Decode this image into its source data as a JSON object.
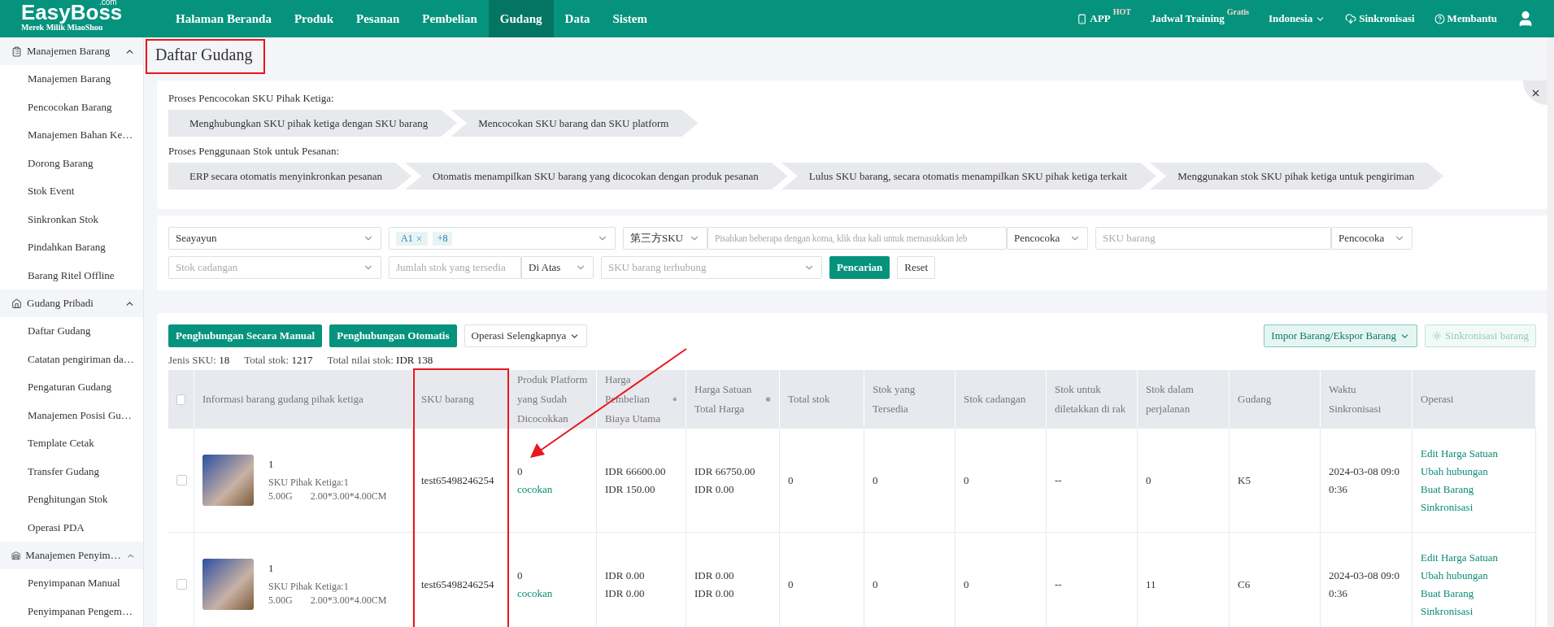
{
  "topbar": {
    "logo": {
      "brand": "EasyBoss",
      "domain": ".com",
      "subtitle": "Merek Milik MiaoShou"
    },
    "nav": [
      {
        "label": "Halaman Beranda",
        "selected": false
      },
      {
        "label": "Produk",
        "selected": false
      },
      {
        "label": "Pesanan",
        "selected": false
      },
      {
        "label": "Pembelian",
        "selected": false
      },
      {
        "label": "Gudang",
        "selected": true
      },
      {
        "label": "Data",
        "selected": false
      },
      {
        "label": "Sistem",
        "selected": false
      }
    ],
    "app": {
      "label": "APP",
      "badge": "HOT"
    },
    "training": {
      "label": "Jadwal Training",
      "badge": "Gratis"
    },
    "language": "Indonesia",
    "sync": "Sinkronisasi",
    "help": "Membantu"
  },
  "sidebar": {
    "groups": [
      {
        "label": "Manajemen Barang",
        "expanded": true,
        "children": [
          "Manajemen Barang",
          "Pencocokan Barang",
          "Manajemen Bahan Ke…",
          "Dorong Barang",
          "Stok Event",
          "Sinkronkan Stok",
          "Pindahkan Barang",
          "Barang Ritel Offline"
        ]
      },
      {
        "label": "Gudang Pribadi",
        "expanded": true,
        "children": [
          "Daftar Gudang",
          "Catatan pengiriman da…",
          "Pengaturan Gudang",
          "Manajemen Posisi Gu…",
          "Template Cetak",
          "Transfer Gudang",
          "Penghitungan Stok",
          "Operasi PDA"
        ]
      },
      {
        "label": "Manajemen Penyim…",
        "expanded": true,
        "children": [
          "Penyimpanan Manual",
          "Penyimpanan Pengem…"
        ]
      }
    ]
  },
  "page_title": "Daftar Gudang",
  "process": [
    {
      "title": "Proses Pencocokan SKU Pihak Ketiga:",
      "steps": [
        "Menghubungkan SKU pihak ketiga dengan SKU barang",
        "Mencocokan SKU barang dan SKU platform"
      ]
    },
    {
      "title": "Proses Penggunaan Stok untuk Pesanan:",
      "steps": [
        "ERP secara otomatis menyinkronkan pesanan",
        "Otomatis menampilkan SKU barang yang dicocokan dengan produk pesanan",
        "Lulus SKU barang, secara otomatis menampilkan SKU pihak ketiga terkait",
        "Menggunakan stok SKU pihak ketiga untuk pengiriman"
      ]
    }
  ],
  "filters": {
    "row_1": {
      "warehouse": "Seayayun",
      "tags": [
        "A1",
        "+8"
      ],
      "sku_type": "第三方SKU",
      "sku_input_placeholder": "Pisahkan beberapa dengan koma, klik dua kali untuk memasukkan leb",
      "match_1": "Pencocoka",
      "sku_barang_placeholder": "SKU barang",
      "match_2": "Pencocoka"
    },
    "row_2": {
      "stock_placeholder": "Stok cadangan",
      "qty_placeholder": "Jumlah stok yang tersedia",
      "qty_mode": "Di Atas",
      "linked_placeholder": "SKU barang terhubung",
      "search_button": "Pencarian",
      "reset_button": "Reset"
    }
  },
  "toolbar": {
    "manual_button": "Penghubungan Secara Manual",
    "auto_button": "Penghubungan Otomatis",
    "more_button": "Operasi Selengkapnya",
    "import_button": "Impor Barang/Ekspor Barang",
    "sync_button": "Sinkronisasi barang"
  },
  "stats": [
    {
      "label": "Jenis SKU:",
      "value": "18"
    },
    {
      "label": "Total stok:",
      "value": "1217"
    },
    {
      "label": "Total nilai stok:",
      "value": "IDR 138"
    }
  ],
  "table": {
    "header_checked": false,
    "columns": [
      {
        "label": "Informasi barang gudang pihak ketiga",
        "help": false
      },
      {
        "label": "SKU barang",
        "help": false
      },
      {
        "label": "Produk Platform yang Sudah Dicocokkan",
        "help": false
      },
      {
        "label": "Harga Pembelian Biaya Utama",
        "help": true
      },
      {
        "label": "Harga Satuan Total Harga",
        "help": true
      },
      {
        "label": "Total stok",
        "help": false
      },
      {
        "label": "Stok yang Tersedia",
        "help": false
      },
      {
        "label": "Stok cadangan",
        "help": false
      },
      {
        "label": "Stok untuk diletakkan di rak",
        "help": false
      },
      {
        "label": "Stok dalam perjalanan",
        "help": false
      },
      {
        "label": "Gudang",
        "help": false
      },
      {
        "label": "Waktu Sinkronisasi",
        "help": false
      },
      {
        "label": "Operasi",
        "help": false
      }
    ],
    "rows": [
      {
        "checked": false,
        "name": "1",
        "third_sku": "SKU Pihak Ketiga:1",
        "weight": "5.00G",
        "size": "2.00*3.00*4.00CM",
        "sku": "test65498246254",
        "matched": "0",
        "match_link": "cocokan",
        "purchase": [
          "IDR 66600.00",
          "IDR 150.00"
        ],
        "unit": [
          "IDR 66750.00",
          "IDR 0.00"
        ],
        "total": "0",
        "available": "0",
        "reserve": "0",
        "shelf": "--",
        "transit": "0",
        "warehouse": "K5",
        "time": "2024-03-08 09:00:36",
        "actions": [
          "Edit Harga Satuan",
          "Ubah hubungan",
          "Buat Barang",
          "Sinkronisasi"
        ]
      },
      {
        "checked": false,
        "name": "1",
        "third_sku": "SKU Pihak Ketiga:1",
        "weight": "5.00G",
        "size": "2.00*3.00*4.00CM",
        "sku": "test65498246254",
        "matched": "0",
        "match_link": "cocokan",
        "purchase": [
          "IDR 0.00",
          "IDR 0.00"
        ],
        "unit": [
          "IDR 0.00",
          "IDR 0.00"
        ],
        "total": "0",
        "available": "0",
        "reserve": "0",
        "shelf": "--",
        "transit": "11",
        "warehouse": "C6",
        "time": "2024-03-08 09:00:36",
        "actions": [
          "Edit Harga Satuan",
          "Ubah hubungan",
          "Buat Barang",
          "Sinkronisasi"
        ]
      }
    ]
  }
}
